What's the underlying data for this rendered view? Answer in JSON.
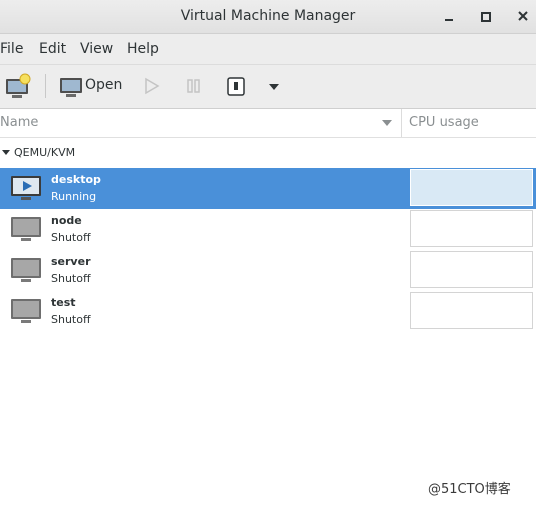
{
  "window": {
    "title": "Virtual Machine Manager"
  },
  "menu": {
    "file": "File",
    "edit": "Edit",
    "view": "View",
    "help": "Help"
  },
  "toolbar": {
    "open_label": "Open"
  },
  "columns": {
    "name": "Name",
    "cpu": "CPU usage"
  },
  "group": {
    "label": "QEMU/KVM"
  },
  "vms": [
    {
      "name": "desktop",
      "status": "Running",
      "selected": true
    },
    {
      "name": "node",
      "status": "Shutoff",
      "selected": false
    },
    {
      "name": "server",
      "status": "Shutoff",
      "selected": false
    },
    {
      "name": "test",
      "status": "Shutoff",
      "selected": false
    }
  ],
  "watermark": "@51CTO博客",
  "colors": {
    "selection": "#4a90d9",
    "cpu_selected_bg": "#d9e9f5"
  }
}
